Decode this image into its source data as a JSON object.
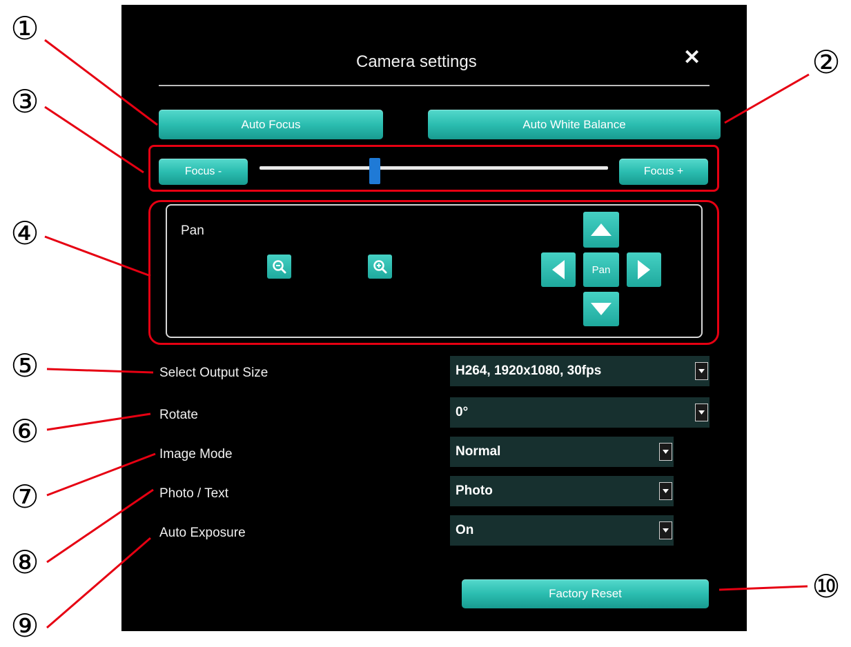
{
  "dialog": {
    "title": "Camera settings",
    "close_icon": "close-icon"
  },
  "buttons": {
    "auto_focus": "Auto Focus",
    "auto_white_balance": "Auto White Balance",
    "focus_minus": "Focus -",
    "focus_plus": "Focus +",
    "factory_reset": "Factory Reset"
  },
  "focus_slider": {
    "value_fraction": 0.33
  },
  "pan": {
    "label": "Pan",
    "center_label": "Pan",
    "zoom_out_icon": "zoom-out-icon",
    "zoom_in_icon": "zoom-in-icon",
    "arrow_icons": [
      "arrow-up-icon",
      "arrow-left-icon",
      "arrow-right-icon",
      "arrow-down-icon"
    ]
  },
  "settings": [
    {
      "label": "Select Output Size",
      "value": "H264, 1920x1080, 30fps"
    },
    {
      "label": "Rotate",
      "value": "0°"
    },
    {
      "label": "Image Mode",
      "value": "Normal"
    },
    {
      "label": "Photo / Text",
      "value": "Photo"
    },
    {
      "label": "Auto Exposure",
      "value": "On"
    }
  ],
  "callouts": [
    "①",
    "②",
    "③",
    "④",
    "⑤",
    "⑥",
    "⑦",
    "⑧",
    "⑨",
    "⑩"
  ],
  "colors": {
    "panel": "#000000",
    "button_teal": "#2bbdb0",
    "slider_thumb": "#1f7ad6",
    "select_bg": "#17302f",
    "annotation_red": "#e60012"
  }
}
